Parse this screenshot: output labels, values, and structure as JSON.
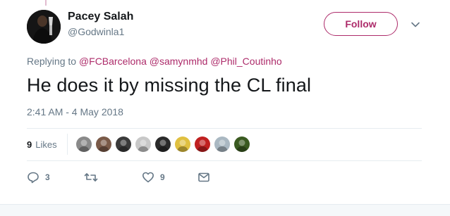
{
  "user": {
    "name": "Pacey Salah",
    "handle": "@Godwinla1"
  },
  "follow_label": "Follow",
  "replying": {
    "prefix": "Replying to",
    "mentions": [
      "@FCBarcelona",
      "@samynmhd",
      "@Phil_Coutinho"
    ]
  },
  "tweet_text": "He does it by missing the CL final",
  "timestamp": "2:41 AM - 4 May 2018",
  "likes": {
    "count": "9",
    "label": "Likes"
  },
  "likers": [
    {
      "icon": "liker-avatar-1",
      "color": "#8a8a8a"
    },
    {
      "icon": "liker-avatar-2",
      "color": "#7a5a48"
    },
    {
      "icon": "liker-avatar-3",
      "color": "#3a3a3a"
    },
    {
      "icon": "liker-avatar-4",
      "color": "#c8c8c8"
    },
    {
      "icon": "liker-avatar-5",
      "color": "#2a2a2a"
    },
    {
      "icon": "liker-avatar-6",
      "color": "#e0c040"
    },
    {
      "icon": "liker-avatar-7",
      "color": "#c02020"
    },
    {
      "icon": "liker-avatar-8",
      "color": "#aab8c2"
    },
    {
      "icon": "liker-avatar-9",
      "color": "#3a5a20"
    }
  ],
  "actions": {
    "reply_count": "3",
    "retweet_count": "",
    "like_count": "9"
  },
  "colors": {
    "accent": "#ad2b6a",
    "secondary_text": "#657786",
    "divider": "#e6ecf0"
  }
}
